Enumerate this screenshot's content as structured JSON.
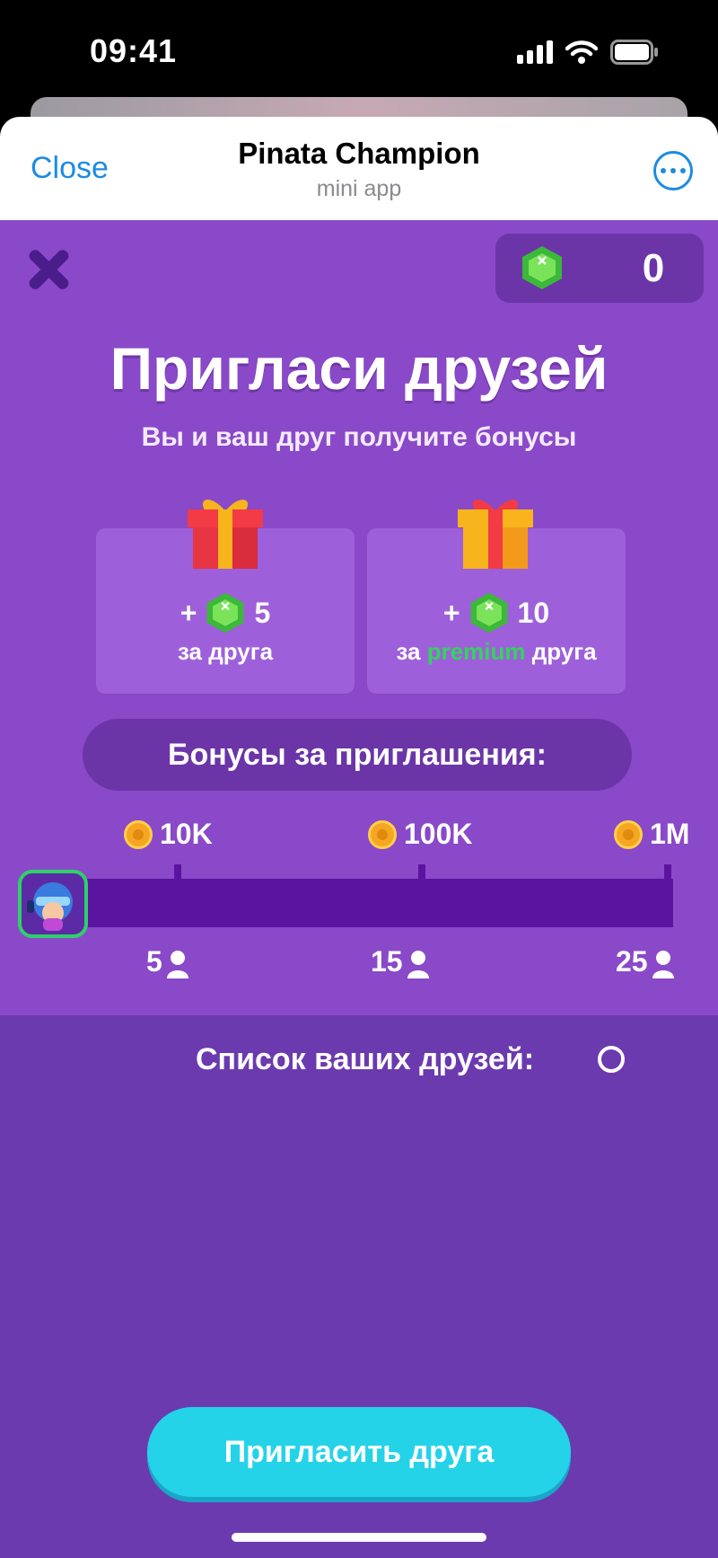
{
  "status_bar": {
    "time": "09:41"
  },
  "header": {
    "close_label": "Close",
    "title": "Pinata Champion",
    "subtitle": "mini app"
  },
  "game": {
    "balance": "0",
    "title": "Пригласи друзей",
    "subtitle": "Вы и ваш друг получите бонусы",
    "cards": [
      {
        "plus": "+",
        "gems": "5",
        "caption": "за друга"
      },
      {
        "plus": "+",
        "gems": "10",
        "caption_prefix": "за",
        "caption_highlight": "premium",
        "caption_suffix": "друга"
      }
    ],
    "bonus_header": "Бонусы за приглашения:",
    "milestones": [
      {
        "reward": "10K",
        "friends": "5"
      },
      {
        "reward": "100K",
        "friends": "15"
      },
      {
        "reward": "1M",
        "friends": "25"
      }
    ],
    "progress": 0,
    "friends_list_title": "Список ваших друзей:",
    "invite_button": "Пригласить друга"
  },
  "colors": {
    "accent": "#25d3e9",
    "background_top": "#8a49c8",
    "background_bottom": "#6b3aaf",
    "premium": "#34d35e"
  }
}
